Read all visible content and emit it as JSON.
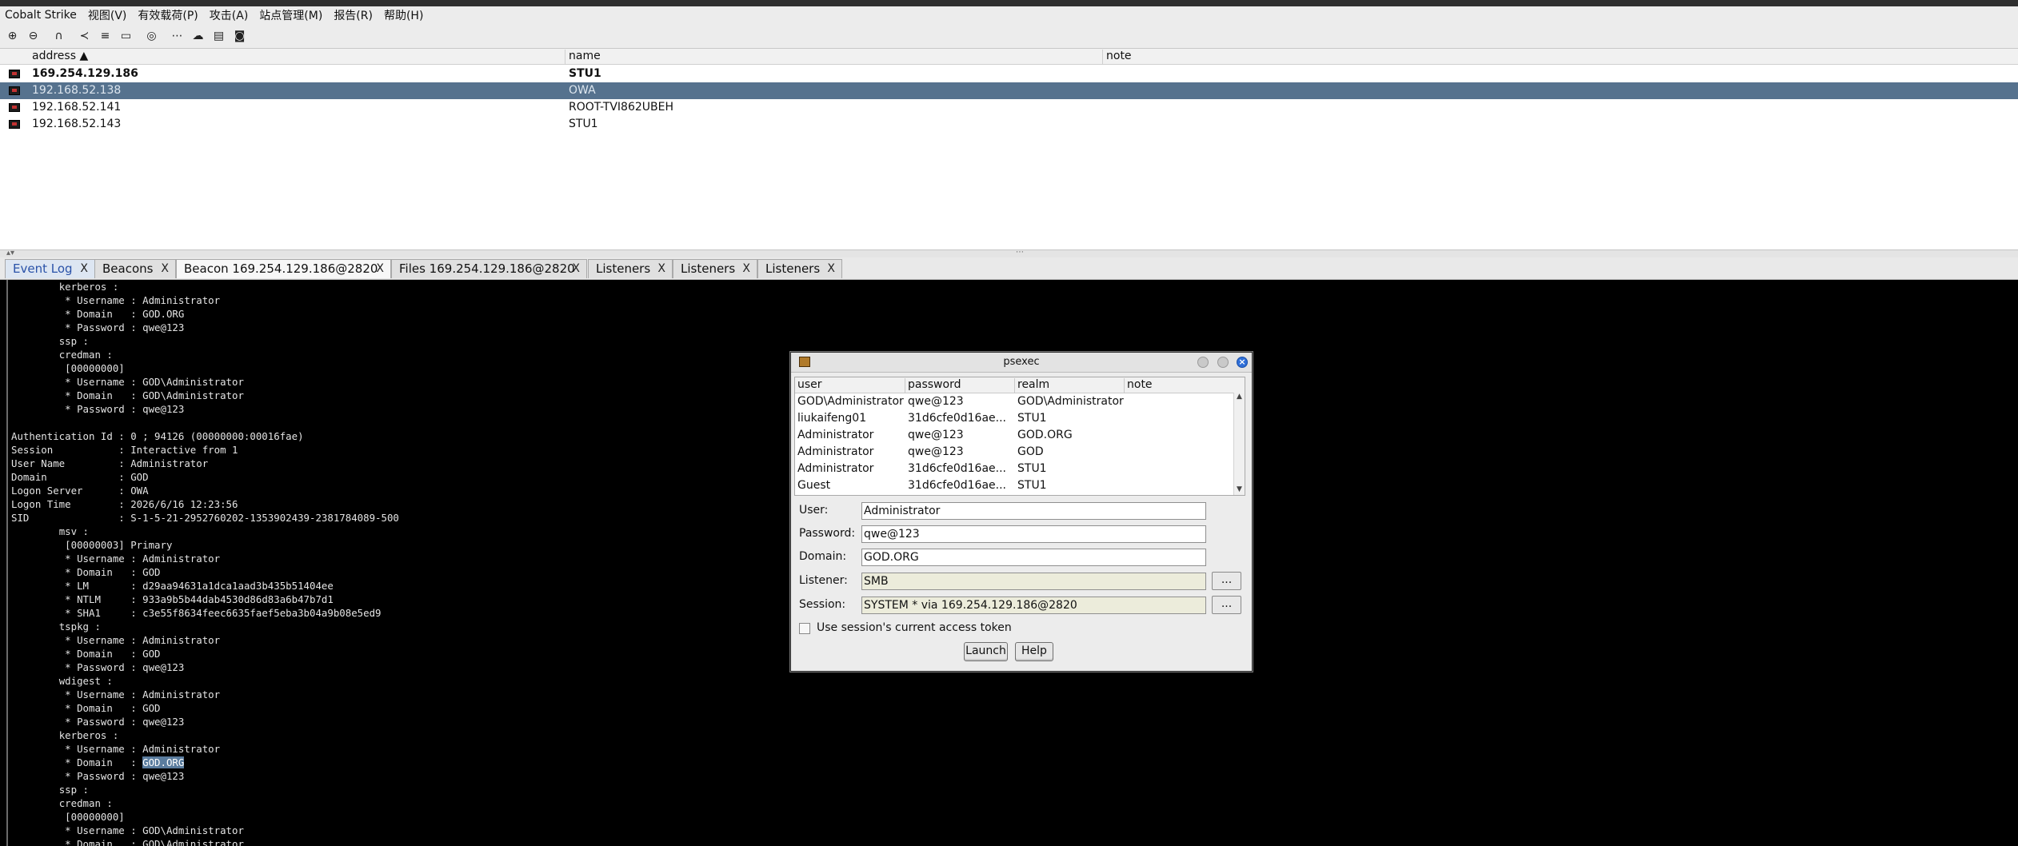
{
  "menu": [
    "Cobalt Strike",
    "视图(V)",
    "有效载荷(P)",
    "攻击(A)",
    "站点管理(M)",
    "报告(R)",
    "帮助(H)"
  ],
  "toolbar_icons": [
    "plus-circle-icon",
    "minus-circle-icon",
    "headphones-icon",
    "share-icon",
    "list-icon",
    "monitor-icon",
    "globe-icon",
    "dots-icon",
    "cloud-download-icon",
    "keyboard-icon",
    "camera-icon"
  ],
  "targets": {
    "columns": {
      "address": "address ▲",
      "name": "name",
      "note": "note"
    },
    "rows": [
      {
        "address": "169.254.129.186",
        "name": "STU1",
        "note": ""
      },
      {
        "address": "192.168.52.138",
        "name": "OWA",
        "note": ""
      },
      {
        "address": "192.168.52.141",
        "name": "ROOT-TVI862UBEH",
        "note": ""
      },
      {
        "address": "192.168.52.143",
        "name": "STU1",
        "note": ""
      }
    ]
  },
  "tabs": [
    {
      "label": "Event Log",
      "close": "X"
    },
    {
      "label": "Beacons",
      "close": "X"
    },
    {
      "label": "Beacon 169.254.129.186@2820",
      "close": "X"
    },
    {
      "label": "Files 169.254.129.186@2820",
      "close": "X"
    },
    {
      "label": "Listeners",
      "close": "X"
    },
    {
      "label": "Listeners",
      "close": "X"
    },
    {
      "label": "Listeners",
      "close": "X"
    }
  ],
  "console": {
    "text_before": "\tkerberos :\n\t * Username : Administrator\n\t * Domain   : GOD.ORG\n\t * Password : qwe@123\n\tssp :\n\tcredman :\n\t [00000000]\n\t * Username : GOD\\Administrator\n\t * Domain   : GOD\\Administrator\n\t * Password : qwe@123\n\nAuthentication Id : 0 ; 94126 (00000000:00016fae)\nSession           : Interactive from 1\nUser Name         : Administrator\nDomain            : GOD\nLogon Server      : OWA\nLogon Time        : 2026/6/16 12:23:56\nSID               : S-1-5-21-2952760202-1353902439-2381784089-500\n\tmsv :\n\t [00000003] Primary\n\t * Username : Administrator\n\t * Domain   : GOD\n\t * LM       : d29aa94631a1dca1aad3b435b51404ee\n\t * NTLM     : 933a9b5b44dab4530d86d83a6b47b7d1\n\t * SHA1     : c3e55f8634feec6635faef5eba3b04a9b08e5ed9\n\ttspkg :\n\t * Username : Administrator\n\t * Domain   : GOD\n\t * Password : qwe@123\n\twdigest :\n\t * Username : Administrator\n\t * Domain   : GOD\n\t * Password : qwe@123\n\tkerberos :\n\t * Username : Administrator\n\t * Domain   : ",
    "highlight": "GOD.ORG",
    "text_after": "\n\t * Password : qwe@123\n\tssp :\n\tcredman :\n\t [00000000]\n\t * Username : GOD\\Administrator\n\t * Domain   : GOD\\Administrator"
  },
  "psexec": {
    "title": "psexec",
    "columns": {
      "user": "user",
      "password": "password",
      "realm": "realm",
      "note": "note"
    },
    "rows": [
      {
        "user": "GOD\\Administrator",
        "password": "qwe@123",
        "realm": "GOD\\Administrator",
        "note": ""
      },
      {
        "user": "liukaifeng01",
        "password": "31d6cfe0d16ae...",
        "realm": "STU1",
        "note": ""
      },
      {
        "user": "Administrator",
        "password": "qwe@123",
        "realm": "GOD.ORG",
        "note": ""
      },
      {
        "user": "Administrator",
        "password": "qwe@123",
        "realm": "GOD",
        "note": ""
      },
      {
        "user": "Administrator",
        "password": "31d6cfe0d16ae...",
        "realm": "STU1",
        "note": ""
      },
      {
        "user": "Guest",
        "password": "31d6cfe0d16ae...",
        "realm": "STU1",
        "note": ""
      }
    ],
    "labels": {
      "user": "User:",
      "password": "Password:",
      "domain": "Domain:",
      "listener": "Listener:",
      "session": "Session:"
    },
    "values": {
      "user": "Administrator",
      "password": "qwe@123",
      "domain": "GOD.ORG",
      "listener": "SMB",
      "session": "SYSTEM * via  169.254.129.186@2820"
    },
    "browse_label": "...",
    "token_label": "Use session's current access token",
    "launch": "Launch",
    "help": "Help"
  }
}
